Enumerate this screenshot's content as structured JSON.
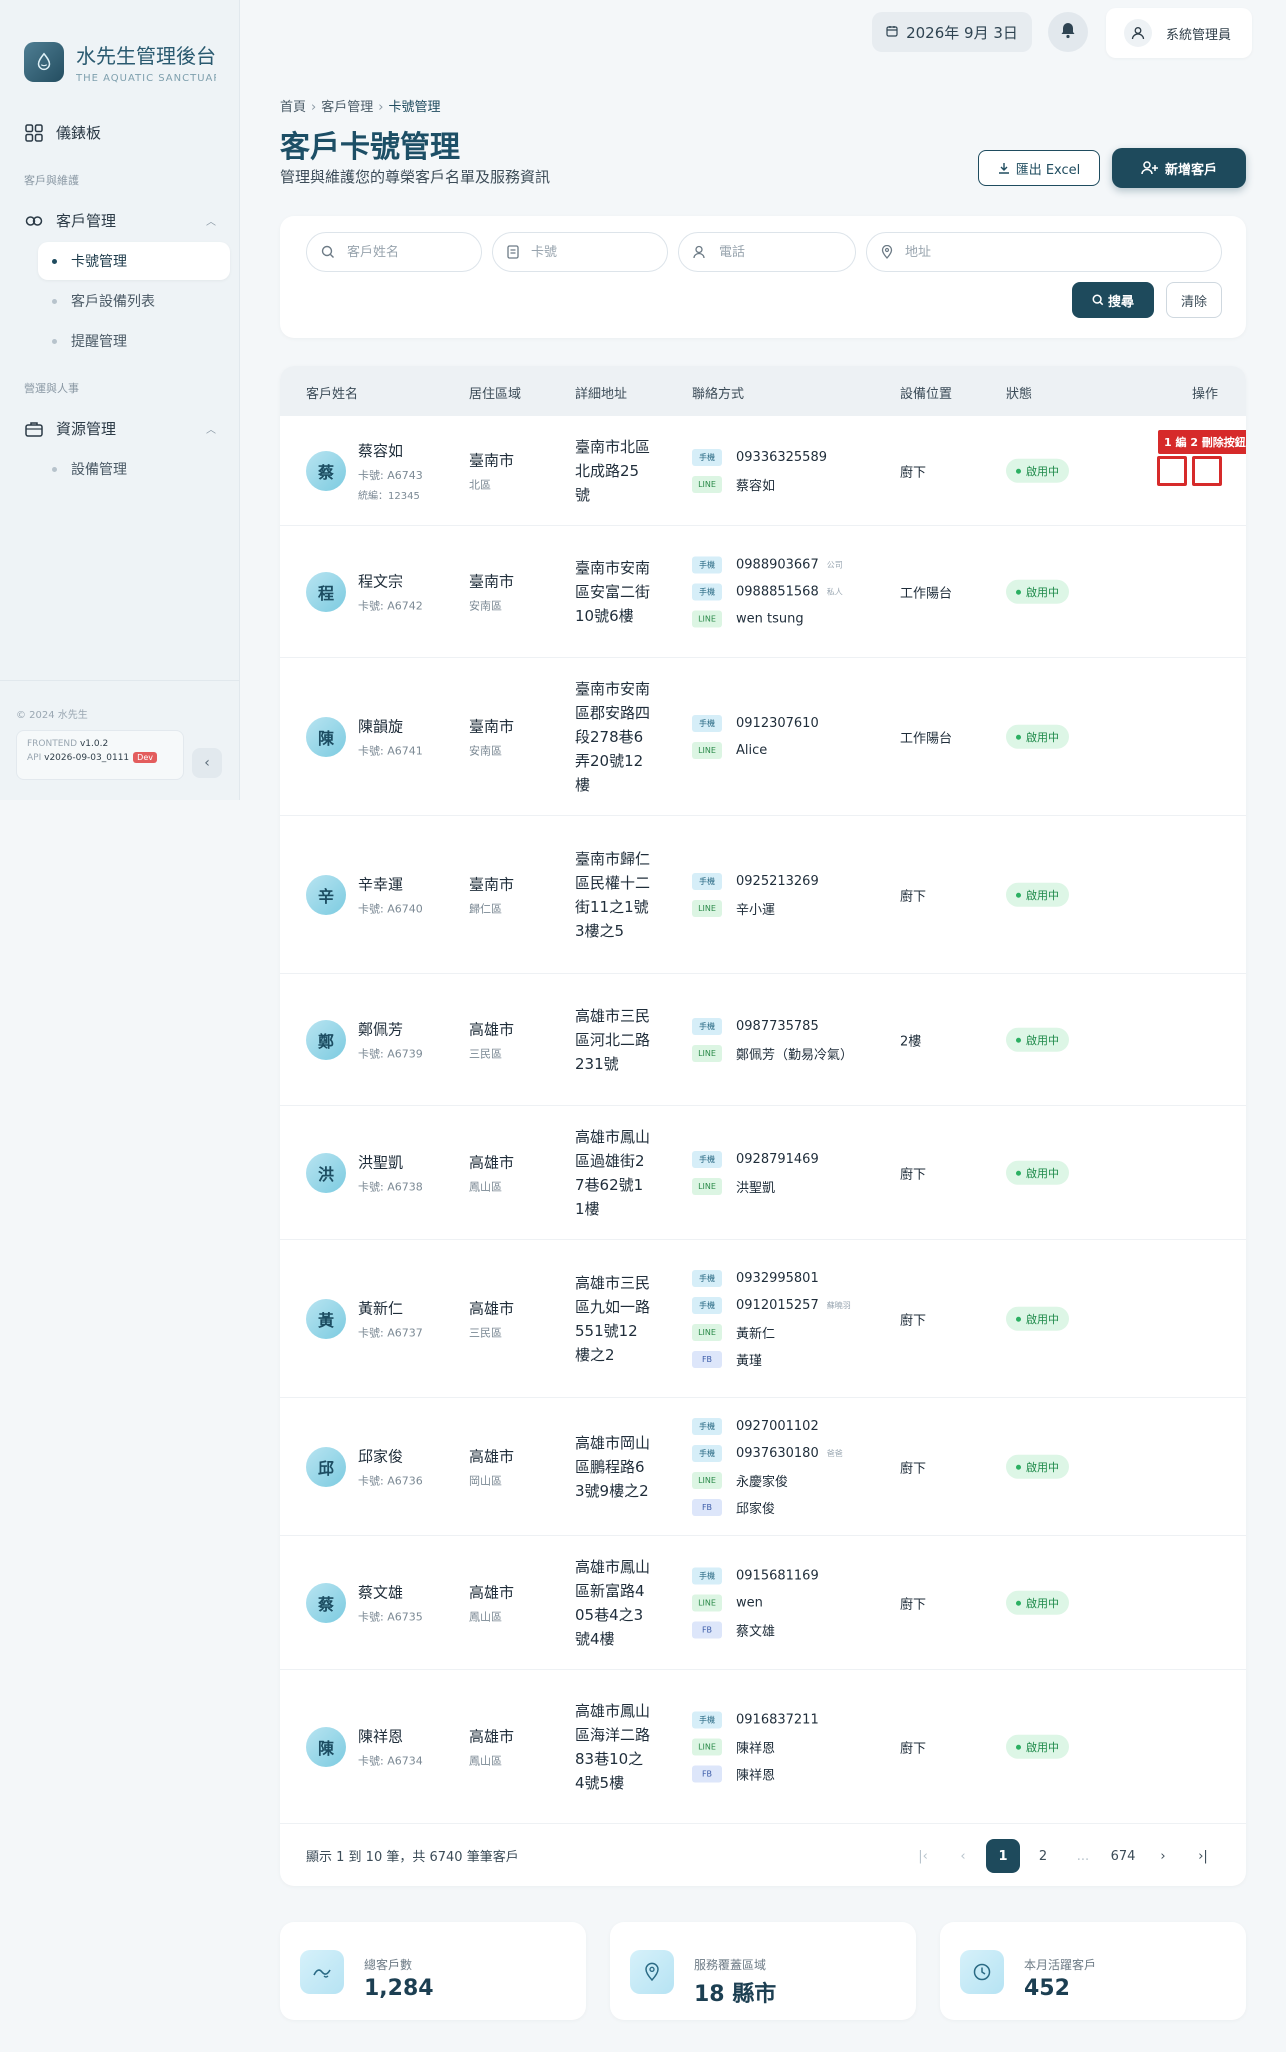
{
  "brand": {
    "title": "水先生管理後台",
    "subtitle": "THE AQUATIC SANCTUARY"
  },
  "sidebar": {
    "dashboard": "儀錶板",
    "section_customer": "客戶與維護",
    "customer_mgmt": "客戶管理",
    "sub_card": "卡號管理",
    "sub_equipment": "客戶設備列表",
    "sub_reminder": "提醒管理",
    "section_ops": "營運與人事",
    "resource_mgmt": "資源管理",
    "sub_device": "設備管理",
    "copyright": "© 2024 水先生",
    "frontend_label": "FRONTEND",
    "frontend_version": "v1.0.2",
    "api_label": "API",
    "api_version": "v2026-09-03_0111",
    "env_badge": "Dev"
  },
  "topbar": {
    "date": "2026年 9月 3日",
    "user": "系統管理員"
  },
  "breadcrumb": {
    "home": "首頁",
    "customer": "客戶管理",
    "current": "卡號管理"
  },
  "page": {
    "title": "客戶卡號管理",
    "description": "管理與維護您的尊榮客戶名單及服務資訊"
  },
  "actions": {
    "export": "匯出 Excel",
    "add": "新增客戶"
  },
  "search": {
    "name_placeholder": "客戶姓名",
    "card_placeholder": "卡號",
    "phone_placeholder": "電話",
    "address_placeholder": "地址",
    "search_button": "搜尋",
    "clear_button": "清除"
  },
  "table": {
    "headers": {
      "name": "客戶姓名",
      "region": "居住區域",
      "address": "詳細地址",
      "contact": "聯絡方式",
      "location": "設備位置",
      "status": "狀態",
      "action": "操作"
    },
    "annotation": "1 編  2 刪除按鈕",
    "rows": [
      {
        "avatar": "蔡",
        "name": "蔡容如",
        "card": "卡號: A6743",
        "extra": "統編：12345",
        "city": "臺南市",
        "district": "北區",
        "address": "臺南市北區北成路25號",
        "location": "廚下",
        "status": "啟用中",
        "contacts": [
          {
            "tag": "手機",
            "value": "09336325589",
            "note": ""
          },
          {
            "tag": "LINE",
            "value": "蔡容如",
            "note": ""
          }
        ]
      },
      {
        "avatar": "程",
        "name": "程文宗",
        "card": "卡號: A6742",
        "extra": "",
        "city": "臺南市",
        "district": "安南區",
        "address": "臺南市安南區安富二街10號6樓",
        "location": "工作陽台",
        "status": "啟用中",
        "contacts": [
          {
            "tag": "手機",
            "value": "0988903667",
            "note": "公司"
          },
          {
            "tag": "手機",
            "value": "0988851568",
            "note": "私人"
          },
          {
            "tag": "LINE",
            "value": "wen tsung",
            "note": ""
          }
        ]
      },
      {
        "avatar": "陳",
        "name": "陳韻旋",
        "card": "卡號: A6741",
        "extra": "",
        "city": "臺南市",
        "district": "安南區",
        "address": "臺南市安南區郡安路四段278巷6弄20號12樓",
        "location": "工作陽台",
        "status": "啟用中",
        "contacts": [
          {
            "tag": "手機",
            "value": "0912307610",
            "note": ""
          },
          {
            "tag": "LINE",
            "value": "Alice",
            "note": ""
          }
        ]
      },
      {
        "avatar": "辛",
        "name": "辛幸運",
        "card": "卡號: A6740",
        "extra": "",
        "city": "臺南市",
        "district": "歸仁區",
        "address": "臺南市歸仁區民權十二街11之1號3樓之5",
        "location": "廚下",
        "status": "啟用中",
        "contacts": [
          {
            "tag": "手機",
            "value": "0925213269",
            "note": ""
          },
          {
            "tag": "LINE",
            "value": "辛小運",
            "note": ""
          }
        ]
      },
      {
        "avatar": "鄭",
        "name": "鄭佩芳",
        "card": "卡號: A6739",
        "extra": "",
        "city": "高雄市",
        "district": "三民區",
        "address": "高雄市三民區河北二路231號",
        "location": "2樓",
        "status": "啟用中",
        "contacts": [
          {
            "tag": "手機",
            "value": "0987735785",
            "note": ""
          },
          {
            "tag": "LINE",
            "value": "鄭佩芳（勤易冷氣）",
            "note": ""
          }
        ]
      },
      {
        "avatar": "洪",
        "name": "洪聖凱",
        "card": "卡號: A6738",
        "extra": "",
        "city": "高雄市",
        "district": "鳳山區",
        "address": "高雄市鳳山區過雄街27巷62號11樓",
        "location": "廚下",
        "status": "啟用中",
        "contacts": [
          {
            "tag": "手機",
            "value": "0928791469",
            "note": ""
          },
          {
            "tag": "LINE",
            "value": "洪聖凱",
            "note": ""
          }
        ]
      },
      {
        "avatar": "黃",
        "name": "黃新仁",
        "card": "卡號: A6737",
        "extra": "",
        "city": "高雄市",
        "district": "三民區",
        "address": "高雄市三民區九如一路551號12樓之2",
        "location": "廚下",
        "status": "啟用中",
        "contacts": [
          {
            "tag": "手機",
            "value": "0932995801",
            "note": ""
          },
          {
            "tag": "手機",
            "value": "0912015257",
            "note": "蘇曉羽"
          },
          {
            "tag": "LINE",
            "value": "黃新仁",
            "note": ""
          },
          {
            "tag": "FB",
            "value": "黃瑾",
            "note": ""
          }
        ]
      },
      {
        "avatar": "邱",
        "name": "邱家俊",
        "card": "卡號: A6736",
        "extra": "",
        "city": "高雄市",
        "district": "岡山區",
        "address": "高雄市岡山區鵬程路63號9樓之2",
        "location": "廚下",
        "status": "啟用中",
        "contacts": [
          {
            "tag": "手機",
            "value": "0927001102",
            "note": ""
          },
          {
            "tag": "手機",
            "value": "0937630180",
            "note": "爸爸"
          },
          {
            "tag": "LINE",
            "value": "永慶家俊",
            "note": ""
          },
          {
            "tag": "FB",
            "value": "邱家俊",
            "note": ""
          }
        ]
      },
      {
        "avatar": "蔡",
        "name": "蔡文雄",
        "card": "卡號: A6735",
        "extra": "",
        "city": "高雄市",
        "district": "鳳山區",
        "address": "高雄市鳳山區新富路405巷4之3號4樓",
        "location": "廚下",
        "status": "啟用中",
        "contacts": [
          {
            "tag": "手機",
            "value": "0915681169",
            "note": ""
          },
          {
            "tag": "LINE",
            "value": "wen",
            "note": ""
          },
          {
            "tag": "FB",
            "value": "蔡文雄",
            "note": ""
          }
        ]
      },
      {
        "avatar": "陳",
        "name": "陳祥恩",
        "card": "卡號: A6734",
        "extra": "",
        "city": "高雄市",
        "district": "鳳山區",
        "address": "高雄市鳳山區海洋二路83巷10之4號5樓",
        "location": "廚下",
        "status": "啟用中",
        "contacts": [
          {
            "tag": "手機",
            "value": "0916837211",
            "note": ""
          },
          {
            "tag": "LINE",
            "value": "陳祥恩",
            "note": ""
          },
          {
            "tag": "FB",
            "value": "陳祥恩",
            "note": ""
          }
        ]
      }
    ]
  },
  "pagination": {
    "summary": "顯示 1 到 10 筆，共 6740 筆筆客戶",
    "pages": [
      "1",
      "2",
      "...",
      "674"
    ],
    "current": "1"
  },
  "stats": [
    {
      "label": "總客戶數",
      "value": "1,284",
      "icon": "water-icon"
    },
    {
      "label": "服務覆蓋區域",
      "value": "18 縣市",
      "icon": "map-pin-icon"
    },
    {
      "label": "本月活躍客戶",
      "value": "452",
      "icon": "clock-icon"
    }
  ]
}
